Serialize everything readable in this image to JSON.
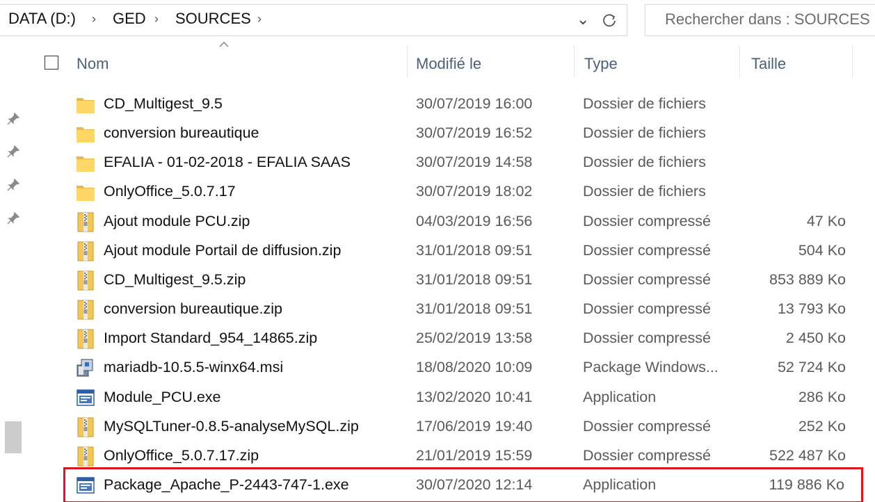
{
  "address": {
    "crumbs": [
      "DATA (D:)",
      "GED",
      "SOURCES"
    ],
    "search_placeholder": "Rechercher dans : SOURCES"
  },
  "columns": {
    "name": "Nom",
    "modified": "Modifié le",
    "type": "Type",
    "size": "Taille"
  },
  "files": [
    {
      "name": "CD_Multigest_9.5",
      "modified": "30/07/2019 16:00",
      "type": "Dossier de fichiers",
      "size": "",
      "icon": "folder-icon"
    },
    {
      "name": "conversion bureautique",
      "modified": "30/07/2019 16:52",
      "type": "Dossier de fichiers",
      "size": "",
      "icon": "folder-icon"
    },
    {
      "name": "EFALIA - 01-02-2018 - EFALIA SAAS",
      "modified": "30/07/2019 14:58",
      "type": "Dossier de fichiers",
      "size": "",
      "icon": "folder-icon"
    },
    {
      "name": "OnlyOffice_5.0.7.17",
      "modified": "30/07/2019 18:02",
      "type": "Dossier de fichiers",
      "size": "",
      "icon": "folder-icon"
    },
    {
      "name": "Ajout module PCU.zip",
      "modified": "04/03/2019 16:56",
      "type": "Dossier compressé",
      "size": "47 Ko",
      "icon": "zip-folder-icon"
    },
    {
      "name": "Ajout module Portail de diffusion.zip",
      "modified": "31/01/2018 09:51",
      "type": "Dossier compressé",
      "size": "504 Ko",
      "icon": "zip-folder-icon"
    },
    {
      "name": "CD_Multigest_9.5.zip",
      "modified": "31/01/2018 09:51",
      "type": "Dossier compressé",
      "size": "853 889 Ko",
      "icon": "zip-folder-icon"
    },
    {
      "name": "conversion bureautique.zip",
      "modified": "31/01/2018 09:51",
      "type": "Dossier compressé",
      "size": "13 793 Ko",
      "icon": "zip-folder-icon"
    },
    {
      "name": "Import Standard_954_14865.zip",
      "modified": "25/02/2019 13:58",
      "type": "Dossier compressé",
      "size": "2 450 Ko",
      "icon": "zip-folder-icon"
    },
    {
      "name": "mariadb-10.5.5-winx64.msi",
      "modified": "18/08/2020 10:09",
      "type": "Package Windows...",
      "size": "52 724 Ko",
      "icon": "msi-package-icon"
    },
    {
      "name": "Module_PCU.exe",
      "modified": "13/02/2020 10:41",
      "type": "Application",
      "size": "286 Ko",
      "icon": "exe-application-icon"
    },
    {
      "name": "MySQLTuner-0.8.5-analyseMySQL.zip",
      "modified": "17/06/2019 19:40",
      "type": "Dossier compressé",
      "size": "252 Ko",
      "icon": "zip-folder-icon"
    },
    {
      "name": "OnlyOffice_5.0.7.17.zip",
      "modified": "21/01/2019 15:59",
      "type": "Dossier compressé",
      "size": "522 487 Ko",
      "icon": "zip-folder-icon"
    },
    {
      "name": "Package_Apache_P-2443-747-1.exe",
      "modified": "30/07/2020 12:14",
      "type": "Application",
      "size": "119 886 Ko",
      "icon": "exe-application-icon",
      "highlighted": true
    }
  ],
  "colors": {
    "highlight_border": "#e0141e",
    "header_text": "#4c607a",
    "folder": "#ffd766"
  }
}
